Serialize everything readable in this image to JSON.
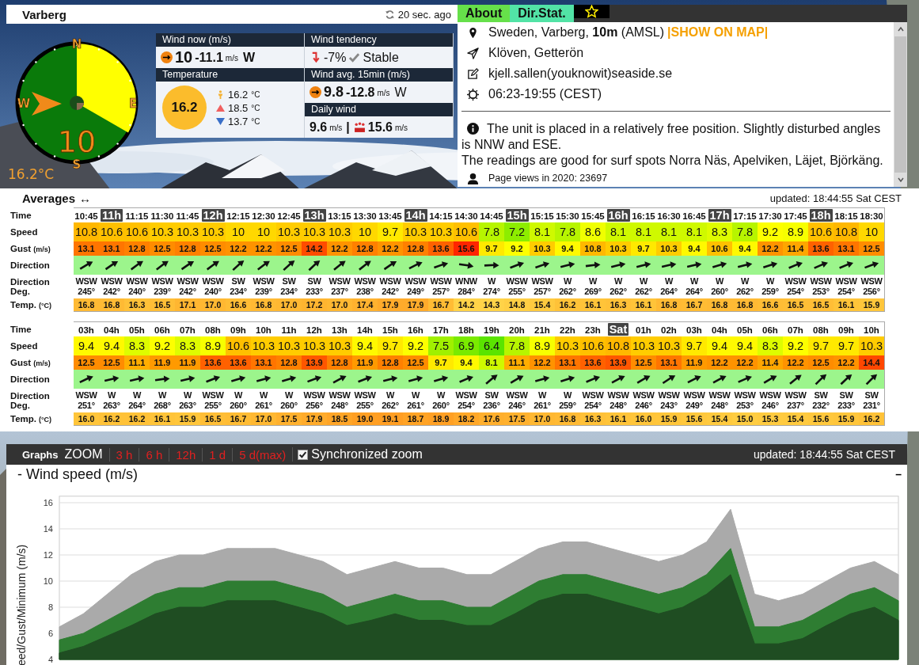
{
  "station": {
    "name": "Varberg",
    "refresh": "20 sec. ago"
  },
  "compass": {
    "letters": [
      "N",
      "E",
      "S",
      "W"
    ],
    "speed": "10",
    "temperature": "16.2°C"
  },
  "now": {
    "wind_now": {
      "header": "Wind now (m/s)",
      "value": "10",
      "max": "-11.1",
      "unit": "m/s",
      "dir": "W"
    },
    "tendency": {
      "header": "Wind tendency",
      "change": "-7%",
      "status": "Stable"
    },
    "temperature": {
      "header": "Temperature",
      "current": "16.2",
      "items": [
        {
          "kind": "feels",
          "value": "16.2",
          "unit": "°C"
        },
        {
          "kind": "max",
          "value": "18.5",
          "unit": "°C"
        },
        {
          "kind": "min",
          "value": "13.7",
          "unit": "°C"
        }
      ]
    },
    "wind_avg": {
      "header": "Wind avg. 15min (m/s)",
      "value": "9.8",
      "max": "-12.8",
      "unit": "m/s",
      "dir": "W"
    },
    "daily": {
      "header": "Daily wind",
      "avg": "9.6",
      "avg_unit": "m/s",
      "separator": "|",
      "max": "15.6",
      "max_unit": "m/s"
    }
  },
  "tabs": [
    {
      "kind": "text",
      "label": "About",
      "selected": true
    },
    {
      "kind": "text",
      "label": "Dir.Stat.",
      "selected": false
    },
    {
      "kind": "star",
      "selected": false
    }
  ],
  "about": {
    "location": "Sweden, Varberg, **10m** (AMSL) ",
    "map_link": "|SHOW ON MAP|",
    "place": "Klöven, Getterön",
    "contact": "kjell.sallen(youknowit)seaside.se",
    "sun": "06:23-19:55 (CEST)",
    "notes": [
      "The unit is placed in a relatively free position. Slightly disturbed angles is NNW and ESE.",
      "The readings are good for surf spots Norra Näs, Apelviken, Läjet, Björkäng."
    ],
    "views": "Page views in 2020: 23697"
  },
  "averages": {
    "title": "Averages",
    "title_icon": "↔",
    "updated": "updated: 18:44:55 Sat CEST"
  },
  "tables": [
    {
      "rows": [
        {
          "kind": "time",
          "label": "Time",
          "cells": [
            {
              "text": "10:45",
              "highlighted": false
            },
            {
              "text": "11h",
              "highlighted": true
            },
            {
              "text": "11:15",
              "highlighted": false
            },
            {
              "text": "11:30",
              "highlighted": false
            },
            {
              "text": "11:45",
              "highlighted": false
            },
            {
              "text": "12h",
              "highlighted": true
            },
            {
              "text": "12:15",
              "highlighted": false
            },
            {
              "text": "12:30",
              "highlighted": false
            },
            {
              "text": "12:45",
              "highlighted": false
            },
            {
              "text": "13h",
              "highlighted": true
            },
            {
              "text": "13:15",
              "highlighted": false
            },
            {
              "text": "13:30",
              "highlighted": false
            },
            {
              "text": "13:45",
              "highlighted": false
            },
            {
              "text": "14h",
              "highlighted": true
            },
            {
              "text": "14:15",
              "highlighted": false
            },
            {
              "text": "14:30",
              "highlighted": false
            },
            {
              "text": "14:45",
              "highlighted": false
            },
            {
              "text": "15h",
              "highlighted": true
            },
            {
              "text": "15:15",
              "highlighted": false
            },
            {
              "text": "15:30",
              "highlighted": false
            },
            {
              "text": "15:45",
              "highlighted": false
            },
            {
              "text": "16h",
              "highlighted": true
            },
            {
              "text": "16:15",
              "highlighted": false
            },
            {
              "text": "16:30",
              "highlighted": false
            },
            {
              "text": "16:45",
              "highlighted": false
            },
            {
              "text": "17h",
              "highlighted": true
            },
            {
              "text": "17:15",
              "highlighted": false
            },
            {
              "text": "17:30",
              "highlighted": false
            },
            {
              "text": "17:45",
              "highlighted": false
            },
            {
              "text": "18h",
              "highlighted": true
            },
            {
              "text": "18:15",
              "highlighted": false
            },
            {
              "text": "18:30",
              "highlighted": false
            }
          ]
        },
        {
          "kind": "speed",
          "label": "Speed",
          "cells": [
            "10.8",
            "10.6",
            "10.6",
            "10.3",
            "10.3",
            "10.3",
            "10",
            "10",
            "10.3",
            "10.3",
            "10.3",
            "10",
            "9.7",
            "10.3",
            "10.3",
            "10.6",
            "7.8",
            "7.2",
            "8.1",
            "7.8",
            "8.6",
            "8.1",
            "8.1",
            "8.1",
            "8.1",
            "8.3",
            "7.8",
            "9.2",
            "8.9",
            "10.6",
            "10.8",
            "10"
          ]
        },
        {
          "kind": "gust",
          "label": "Gust",
          "unit": "(m/s)",
          "cells": [
            "13.1",
            "13.1",
            "12.8",
            "12.5",
            "12.8",
            "12.5",
            "12.2",
            "12.2",
            "12.5",
            "14.2",
            "12.2",
            "12.8",
            "12.2",
            "12.8",
            "13.6",
            "15.6",
            "9.7",
            "9.2",
            "10.3",
            "9.4",
            "10.8",
            "10.3",
            "9.7",
            "10.3",
            "9.4",
            "10.6",
            "9.4",
            "12.2",
            "11.4",
            "13.6",
            "13.1",
            "12.5"
          ]
        },
        {
          "kind": "arrows",
          "label": "Direction"
        },
        {
          "kind": "dirdeg",
          "label": "Direction Deg.",
          "cells": [
            {
              "dir": "WSW",
              "deg": "245°"
            },
            {
              "dir": "WSW",
              "deg": "242°"
            },
            {
              "dir": "WSW",
              "deg": "240°"
            },
            {
              "dir": "WSW",
              "deg": "239°"
            },
            {
              "dir": "WSW",
              "deg": "242°"
            },
            {
              "dir": "WSW",
              "deg": "240°"
            },
            {
              "dir": "SW",
              "deg": "234°"
            },
            {
              "dir": "WSW",
              "deg": "239°"
            },
            {
              "dir": "SW",
              "deg": "234°"
            },
            {
              "dir": "SW",
              "deg": "233°"
            },
            {
              "dir": "WSW",
              "deg": "237°"
            },
            {
              "dir": "WSW",
              "deg": "238°"
            },
            {
              "dir": "WSW",
              "deg": "242°"
            },
            {
              "dir": "WSW",
              "deg": "249°"
            },
            {
              "dir": "WSW",
              "deg": "257°"
            },
            {
              "dir": "WNW",
              "deg": "284°"
            },
            {
              "dir": "W",
              "deg": "274°"
            },
            {
              "dir": "WSW",
              "deg": "255°"
            },
            {
              "dir": "WSW",
              "deg": "257°"
            },
            {
              "dir": "W",
              "deg": "262°"
            },
            {
              "dir": "W",
              "deg": "269°"
            },
            {
              "dir": "W",
              "deg": "262°"
            },
            {
              "dir": "W",
              "deg": "262°"
            },
            {
              "dir": "W",
              "deg": "264°"
            },
            {
              "dir": "W",
              "deg": "264°"
            },
            {
              "dir": "W",
              "deg": "260°"
            },
            {
              "dir": "W",
              "deg": "262°"
            },
            {
              "dir": "W",
              "deg": "259°"
            },
            {
              "dir": "WSW",
              "deg": "254°"
            },
            {
              "dir": "WSW",
              "deg": "253°"
            },
            {
              "dir": "WSW",
              "deg": "254°"
            },
            {
              "dir": "WSW",
              "deg": "256°"
            }
          ]
        },
        {
          "kind": "temp",
          "label": "Temp.",
          "unit": "(°C)",
          "cells": [
            "16.8",
            "16.8",
            "16.3",
            "16.5",
            "17.1",
            "17.0",
            "16.6",
            "16.8",
            "17.0",
            "17.2",
            "17.0",
            "17.4",
            "17.9",
            "17.9",
            "16.7",
            "14.2",
            "14.3",
            "14.8",
            "15.4",
            "16.2",
            "16.1",
            "16.3",
            "16.1",
            "16.8",
            "16.7",
            "16.8",
            "16.8",
            "16.6",
            "16.5",
            "16.5",
            "16.1",
            "15.9"
          ]
        }
      ]
    },
    {
      "rows": [
        {
          "kind": "time",
          "label": "Time",
          "cells": [
            {
              "text": "03h",
              "highlighted": false
            },
            {
              "text": "04h",
              "highlighted": false
            },
            {
              "text": "05h",
              "highlighted": false
            },
            {
              "text": "06h",
              "highlighted": false
            },
            {
              "text": "07h",
              "highlighted": false
            },
            {
              "text": "08h",
              "highlighted": false
            },
            {
              "text": "09h",
              "highlighted": false
            },
            {
              "text": "10h",
              "highlighted": false
            },
            {
              "text": "11h",
              "highlighted": false
            },
            {
              "text": "12h",
              "highlighted": false
            },
            {
              "text": "13h",
              "highlighted": false
            },
            {
              "text": "14h",
              "highlighted": false
            },
            {
              "text": "15h",
              "highlighted": false
            },
            {
              "text": "16h",
              "highlighted": false
            },
            {
              "text": "17h",
              "highlighted": false
            },
            {
              "text": "18h",
              "highlighted": false
            },
            {
              "text": "19h",
              "highlighted": false
            },
            {
              "text": "20h",
              "highlighted": false
            },
            {
              "text": "21h",
              "highlighted": false
            },
            {
              "text": "22h",
              "highlighted": false
            },
            {
              "text": "23h",
              "highlighted": false
            },
            {
              "text": "Sat",
              "highlighted": true
            },
            {
              "text": "01h",
              "highlighted": false
            },
            {
              "text": "02h",
              "highlighted": false
            },
            {
              "text": "03h",
              "highlighted": false
            },
            {
              "text": "04h",
              "highlighted": false
            },
            {
              "text": "05h",
              "highlighted": false
            },
            {
              "text": "06h",
              "highlighted": false
            },
            {
              "text": "07h",
              "highlighted": false
            },
            {
              "text": "08h",
              "highlighted": false
            },
            {
              "text": "09h",
              "highlighted": false
            },
            {
              "text": "10h",
              "highlighted": false
            }
          ]
        },
        {
          "kind": "speed",
          "label": "Speed",
          "cells": [
            "9.4",
            "9.4",
            "8.3",
            "9.2",
            "8.3",
            "8.9",
            "10.6",
            "10.3",
            "10.3",
            "10.3",
            "10.3",
            "9.4",
            "9.7",
            "9.2",
            "7.5",
            "6.9",
            "6.4",
            "7.8",
            "8.9",
            "10.3",
            "10.6",
            "10.8",
            "10.3",
            "10.3",
            "9.7",
            "9.4",
            "9.4",
            "8.3",
            "9.2",
            "9.7",
            "9.7",
            "10.3"
          ]
        },
        {
          "kind": "gust",
          "label": "Gust",
          "unit": "(m/s)",
          "cells": [
            "12.5",
            "12.5",
            "11.1",
            "11.9",
            "11.9",
            "13.6",
            "13.6",
            "13.1",
            "12.8",
            "13.9",
            "12.8",
            "11.9",
            "12.8",
            "12.5",
            "9.7",
            "9.4",
            "8.1",
            "11.1",
            "12.2",
            "13.1",
            "13.6",
            "13.9",
            "12.5",
            "13.1",
            "11.9",
            "12.2",
            "12.2",
            "11.4",
            "12.2",
            "12.5",
            "12.2",
            "14.4"
          ]
        },
        {
          "kind": "arrows",
          "label": "Direction"
        },
        {
          "kind": "dirdeg",
          "label": "Direction Deg.",
          "cells": [
            {
              "dir": "WSW",
              "deg": "251°"
            },
            {
              "dir": "W",
              "deg": "263°"
            },
            {
              "dir": "W",
              "deg": "264°"
            },
            {
              "dir": "W",
              "deg": "268°"
            },
            {
              "dir": "W",
              "deg": "263°"
            },
            {
              "dir": "WSW",
              "deg": "255°"
            },
            {
              "dir": "W",
              "deg": "260°"
            },
            {
              "dir": "W",
              "deg": "261°"
            },
            {
              "dir": "W",
              "deg": "260°"
            },
            {
              "dir": "WSW",
              "deg": "256°"
            },
            {
              "dir": "WSW",
              "deg": "248°"
            },
            {
              "dir": "WSW",
              "deg": "255°"
            },
            {
              "dir": "W",
              "deg": "262°"
            },
            {
              "dir": "W",
              "deg": "261°"
            },
            {
              "dir": "W",
              "deg": "260°"
            },
            {
              "dir": "WSW",
              "deg": "254°"
            },
            {
              "dir": "SW",
              "deg": "236°"
            },
            {
              "dir": "WSW",
              "deg": "246°"
            },
            {
              "dir": "W",
              "deg": "261°"
            },
            {
              "dir": "W",
              "deg": "259°"
            },
            {
              "dir": "WSW",
              "deg": "254°"
            },
            {
              "dir": "WSW",
              "deg": "248°"
            },
            {
              "dir": "WSW",
              "deg": "246°"
            },
            {
              "dir": "WSW",
              "deg": "243°"
            },
            {
              "dir": "WSW",
              "deg": "249°"
            },
            {
              "dir": "WSW",
              "deg": "248°"
            },
            {
              "dir": "WSW",
              "deg": "253°"
            },
            {
              "dir": "WSW",
              "deg": "246°"
            },
            {
              "dir": "WSW",
              "deg": "237°"
            },
            {
              "dir": "SW",
              "deg": "232°"
            },
            {
              "dir": "SW",
              "deg": "233°"
            },
            {
              "dir": "SW",
              "deg": "231°"
            }
          ]
        },
        {
          "kind": "temp",
          "label": "Temp.",
          "unit": "(°C)",
          "cells": [
            "16.0",
            "16.2",
            "16.2",
            "16.1",
            "15.9",
            "16.5",
            "16.7",
            "17.0",
            "17.5",
            "17.9",
            "18.5",
            "19.0",
            "19.1",
            "18.7",
            "18.9",
            "18.2",
            "17.6",
            "17.5",
            "17.0",
            "16.8",
            "16.3",
            "16.1",
            "16.0",
            "15.9",
            "15.6",
            "15.4",
            "15.0",
            "15.3",
            "15.4",
            "15.6",
            "15.9",
            "16.2"
          ]
        }
      ]
    }
  ],
  "graphs": {
    "title": "Graphs",
    "zoom_label": "ZOOM",
    "zoom_options": [
      "3 h",
      "6 h",
      "12h",
      "1 d",
      "5 d(max)"
    ],
    "sync": {
      "label": "Synchronized zoom",
      "checked": true
    },
    "updated": "updated: 18:44:55 Sat CEST",
    "minimize": "–",
    "chart_data": {
      "type": "area",
      "title": "- Wind speed (m/s)",
      "ylabel": "eed/Gust/Minimum (m/s)",
      "ylim": [
        4,
        16.5
      ],
      "yticks": [
        4,
        6,
        8,
        10,
        12,
        14,
        16
      ],
      "grid": true,
      "series": [
        {
          "color": "#aaaaaa",
          "values": [
            6.5,
            7.5,
            9,
            10.5,
            11.5,
            12,
            12,
            12.5,
            12.5,
            12.5,
            12,
            11.5,
            10.5,
            11,
            11.5,
            11,
            11,
            10.5,
            10.5,
            11.5,
            12.5,
            13,
            13,
            12.5,
            12,
            11.5,
            12,
            13,
            15.5,
            9,
            8.5,
            9,
            10,
            11,
            11.5,
            10.5
          ]
        },
        {
          "color": "#2e7d32",
          "values": [
            5.5,
            6,
            7,
            8,
            9,
            9.5,
            9.5,
            10,
            10,
            10,
            9.5,
            9,
            8,
            8.5,
            9,
            8.5,
            8.5,
            8,
            8,
            9,
            10,
            10.5,
            10.5,
            10,
            9.5,
            9,
            9.5,
            10.5,
            12.5,
            6.5,
            6.5,
            7,
            8,
            9,
            9.5,
            8.5
          ]
        },
        {
          "color": "#1f4d22",
          "values": [
            4.5,
            5,
            5.8,
            6.6,
            7.5,
            8,
            8,
            8.5,
            8.5,
            8.5,
            8,
            7.5,
            6.6,
            7,
            7.5,
            7,
            7,
            6.6,
            6.6,
            7.5,
            8.5,
            9,
            9,
            8.5,
            8,
            7.5,
            8,
            9,
            10.5,
            5.2,
            5.2,
            5.6,
            6.6,
            7.5,
            8,
            7
          ]
        }
      ]
    }
  }
}
